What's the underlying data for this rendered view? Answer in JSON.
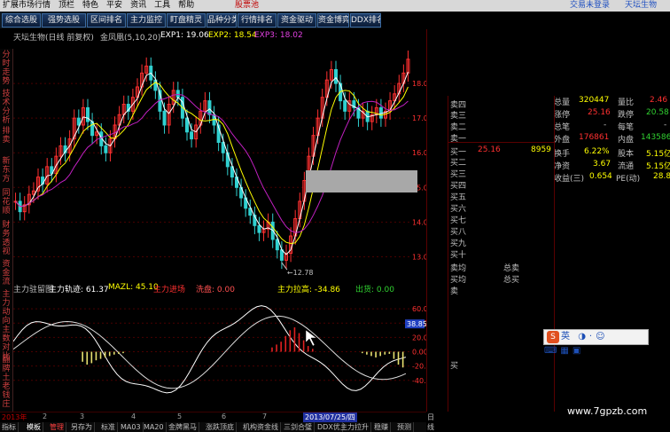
{
  "menu": {
    "items": [
      "扩展市场行情",
      "顶栏",
      "特色",
      "平安",
      "资讯",
      "工具",
      "帮助"
    ],
    "badge": "股票池",
    "trade_status": "交易未登录",
    "stock_name": "天坛生物"
  },
  "toolbar": {
    "tabs": [
      "综合选股",
      "强势选股",
      "区间排名",
      "主力监控",
      "盯盘精灵",
      "品种分类",
      "行情排名",
      "资金驱动",
      "资金博弈",
      "DDX排名"
    ],
    "active": 0
  },
  "left_tabs": [
    "分时走势",
    "技术分析",
    "排卖",
    "新东方",
    "同花顺",
    "财务透视",
    "资金流",
    "主力动向",
    "主数对比",
    "翻牌土",
    "老钱庄",
    "牛又公路"
  ],
  "main_chart": {
    "title": "天坛生物(日线 前复权)",
    "indicator": "金凤凰(5,10,20)",
    "exp1_label": "EXP1: 19.06",
    "exp2_label": "EXP2: 18.54",
    "exp3_label": "EXP3: 18.02",
    "ticks": [
      "18.00",
      "17.00",
      "16.00",
      "15.00",
      "14.00",
      "13.00"
    ],
    "low_annotation": "12.78",
    "colors": {
      "up": "#ff3030",
      "down": "#30d0d0",
      "exp1": "#ffffff",
      "exp2": "#ffff00",
      "exp3": "#c020c0",
      "grid": "#4a0000"
    }
  },
  "chart_data": {
    "type": "candlestick",
    "ylim": [
      12.5,
      19.0
    ],
    "y_ticks": [
      13.0,
      14.0,
      15.0,
      16.0,
      17.0,
      18.0
    ],
    "low_point": 12.78,
    "close_series": [
      14.6,
      14.3,
      14.5,
      14.8,
      14.9,
      15.3,
      15.1,
      15.6,
      15.4,
      15.9,
      16.2,
      16.0,
      16.4,
      17.0,
      16.8,
      17.3,
      16.9,
      16.5,
      16.6,
      16.2,
      16.0,
      16.4,
      16.8,
      17.1,
      17.4,
      17.2,
      17.6,
      17.9,
      18.3,
      18.5,
      18.1,
      17.8,
      17.2,
      16.8,
      17.4,
      17.8,
      17.6,
      17.0,
      16.6,
      16.4,
      16.8,
      17.2,
      17.5,
      17.1,
      16.8,
      16.3,
      16.0,
      15.6,
      15.3,
      15.0,
      14.7,
      14.4,
      14.2,
      13.9,
      13.7,
      13.8,
      14.0,
      13.5,
      13.2,
      12.9,
      13.1,
      13.6,
      14.1,
      14.6,
      15.2,
      15.9,
      16.5,
      17.0,
      17.6,
      18.1,
      18.4,
      18.0,
      17.5,
      17.2,
      17.5,
      17.3,
      17.0,
      17.2,
      16.9,
      17.1,
      17.3,
      17.0,
      17.2,
      17.5,
      17.7,
      18.0,
      18.3,
      18.7
    ]
  },
  "sub_chart": {
    "name": "主力驻留图",
    "label1": "主力轨迹: 61.37",
    "label2": "MAZL: 45.10",
    "label3": "主力进场",
    "label4": "洗盘: 0.00",
    "label5": "主力拉高: -34.86",
    "label6": "出货: 0.00",
    "ticks": [
      "60.00",
      "40.00",
      "20.00",
      "0.00",
      "-20.00",
      "-40.00"
    ],
    "current_tag": "38.85"
  },
  "date_bar": {
    "year": "2013年",
    "months": [
      "2",
      "3",
      "4",
      "5",
      "6",
      "7"
    ],
    "cursor_date": "2013/07/25/四",
    "period": "日线"
  },
  "bottom_tabs": [
    "指标",
    "模板",
    "管理",
    "另存为",
    "标准",
    "MA03",
    "MA20",
    "金牌黑马",
    "涨跌顶底",
    "机构资金线",
    "三剑合璧",
    "DDX优",
    "主力拉升",
    "稳赚",
    "预测"
  ],
  "order_book": {
    "sell_labels": [
      "卖四",
      "卖三",
      "卖二",
      "卖一"
    ],
    "sell_price": "25.16",
    "sell_vol": "8959",
    "buy_labels": [
      "买一",
      "买二",
      "买三",
      "买四",
      "买五",
      "买六",
      "买七",
      "买八",
      "买九",
      "买十"
    ],
    "avg_sell": "卖均",
    "avg_buy": "买均",
    "total_sell": "总卖",
    "total_buy": "总买",
    "trade_sell": "卖",
    "trade_buy": "买"
  },
  "quote": {
    "total_vol_label": "总量",
    "total_vol": "320447",
    "vol_ratio_label": "量比",
    "vol_ratio": "2.46",
    "limit_up_label": "涨停",
    "limit_up": "25.16",
    "limit_down_label": "跌停",
    "limit_down": "20.58",
    "total_deals_label": "总笔",
    "total_deals": "-",
    "per_deal_label": "每笔",
    "per_deal": "-",
    "outer_label": "外盘",
    "outer": "176861",
    "inner_label": "内盘",
    "inner": "143586",
    "turnover_label": "换手",
    "turnover": "6.22%",
    "share_label": "股本",
    "share": "5.15亿",
    "net_asset_label": "净资",
    "net_asset": "3.67",
    "float_label": "流通",
    "float": "5.15亿",
    "eps_label": "收益(三)",
    "eps": "0.654",
    "pe_label": "PE(动)",
    "pe": "28.8"
  },
  "ime": {
    "label": "英"
  },
  "watermark": "www.7gpzb.com"
}
